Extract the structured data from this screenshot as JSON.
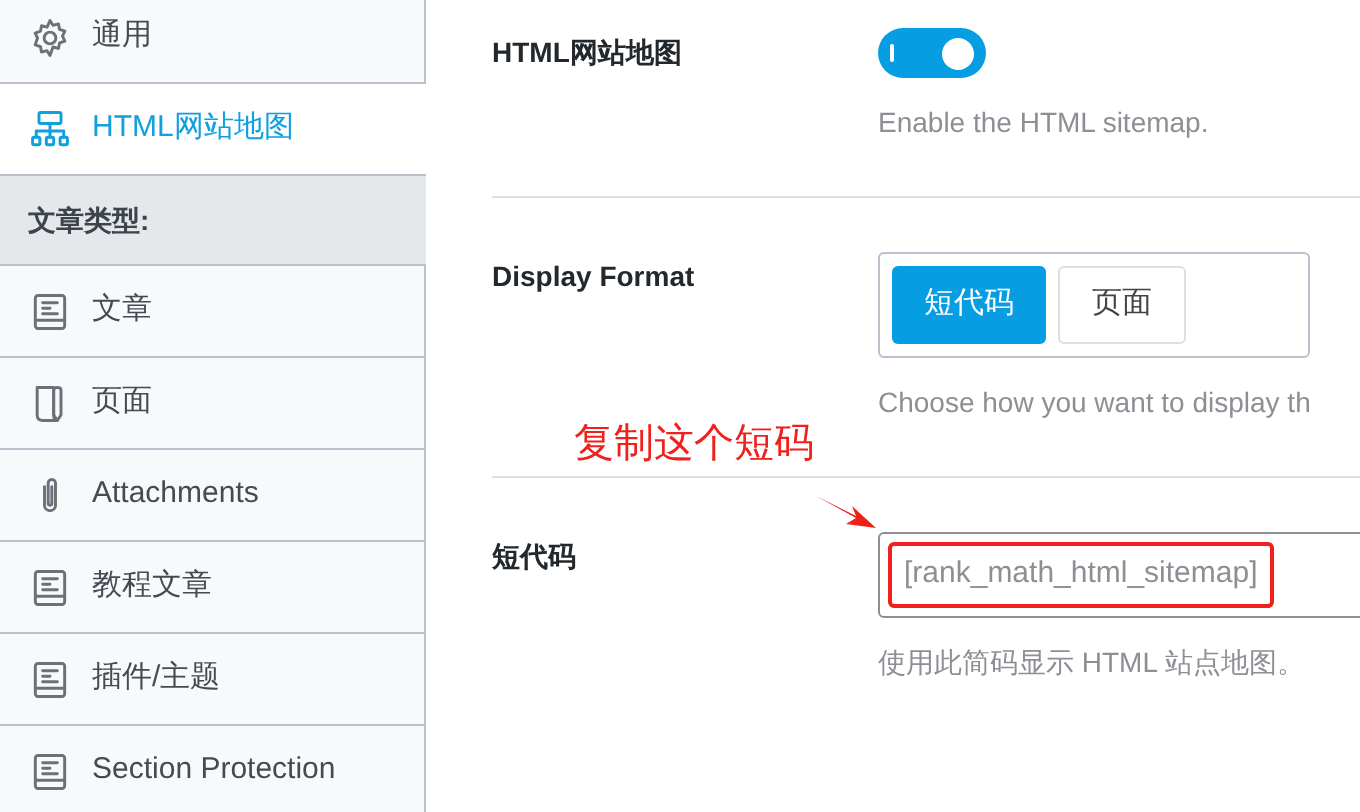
{
  "sidebar": {
    "items": [
      {
        "kind": "settings",
        "label": "通用",
        "selected": false
      },
      {
        "kind": "sitemap",
        "label": "HTML网站地图",
        "selected": true
      },
      {
        "kind": "heading",
        "label": "文章类型:"
      },
      {
        "kind": "post",
        "label": "文章",
        "selected": false
      },
      {
        "kind": "page",
        "label": "页面",
        "selected": false
      },
      {
        "kind": "attachment",
        "label": "Attachments",
        "selected": false
      },
      {
        "kind": "post",
        "label": "教程文章",
        "selected": false
      },
      {
        "kind": "post",
        "label": "插件/主题",
        "selected": false
      },
      {
        "kind": "post",
        "label": "Section Protection",
        "selected": false
      }
    ]
  },
  "settings": [
    {
      "kind": "toggle",
      "label": "HTML网站地图",
      "on": true,
      "description": "Enable the HTML sitemap."
    },
    {
      "kind": "choice",
      "label": "Display Format",
      "options": [
        {
          "label": "短代码",
          "selected": true
        },
        {
          "label": "页面",
          "selected": false
        }
      ],
      "description": "Choose how you want to display th"
    },
    {
      "kind": "text",
      "label": "短代码",
      "value": "[rank_math_html_sitemap]",
      "description": "使用此简码显示 HTML 站点地图。"
    }
  ],
  "annotation": {
    "text": "复制这个短码"
  }
}
